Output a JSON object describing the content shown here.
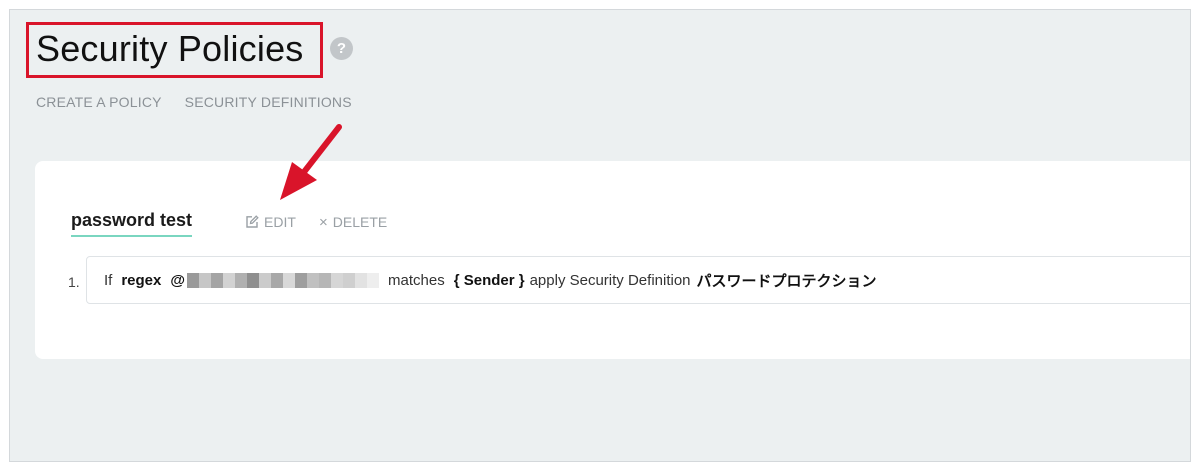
{
  "page": {
    "title": "Security Policies",
    "help_symbol": "?"
  },
  "nav": {
    "items": [
      {
        "label": "CREATE A POLICY"
      },
      {
        "label": "SECURITY DEFINITIONS"
      }
    ]
  },
  "policy": {
    "name": "password test",
    "edit_label": "EDIT",
    "delete_label": "DELETE",
    "delete_symbol": "×",
    "rule": {
      "number": "1.",
      "if_label": "If",
      "condition_type": "regex",
      "pattern_prefix": "@",
      "matches_label": "matches",
      "field": "{ Sender }",
      "apply_label": "apply Security Definition",
      "definition": "パスワードプロテクション"
    }
  },
  "colors": {
    "highlight_box": "#d9142a",
    "annotation_arrow": "#d9142a",
    "tab_underline": "#7ad6c0",
    "page_background": "#ecf0f1"
  },
  "icons": [
    "help-circle-icon",
    "edit-icon",
    "close-icon",
    "annotation-arrow"
  ]
}
